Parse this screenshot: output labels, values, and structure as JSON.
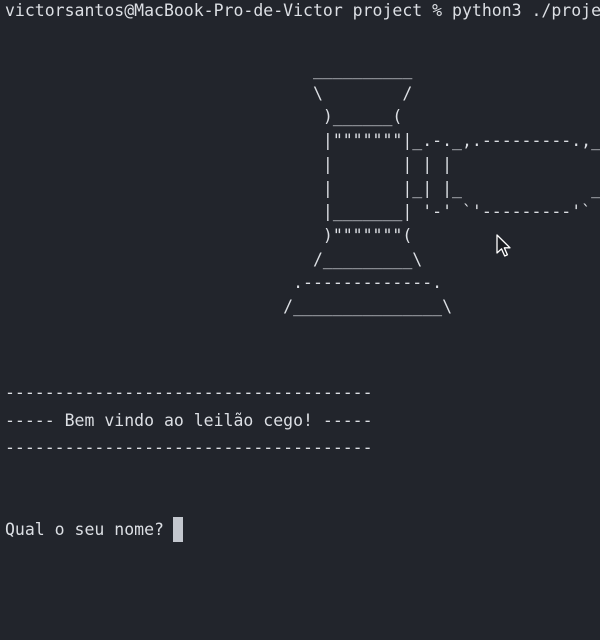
{
  "terminal": {
    "prompt_line": "victorsantos@MacBook-Pro-de-Victor project % python3 ./proje",
    "gavel_art": "                               __________\n                               \\        /\n                                )______(\n                                |\"\"\"\"\"\"\"|_.-._,.---------.,_.-._\n                                |       | | |               | | ''\n                                |       |_| |_             _| |_..\n                                |_______| '-' `'---------'` '-'\n                                )\"\"\"\"\"\"\"(\n                               /_________\\\n                             .-------------.\n                            /_______________\\",
    "separator_top": "-------------------------------------",
    "welcome_text": "----- Bem vindo ao leilão cego! -----",
    "separator_bottom": "-------------------------------------",
    "input_prompt": "Qual o seu nome? ",
    "colors": {
      "background": "#22252c",
      "text": "#dcdfe4",
      "cursor": "#c3c7ce"
    }
  }
}
